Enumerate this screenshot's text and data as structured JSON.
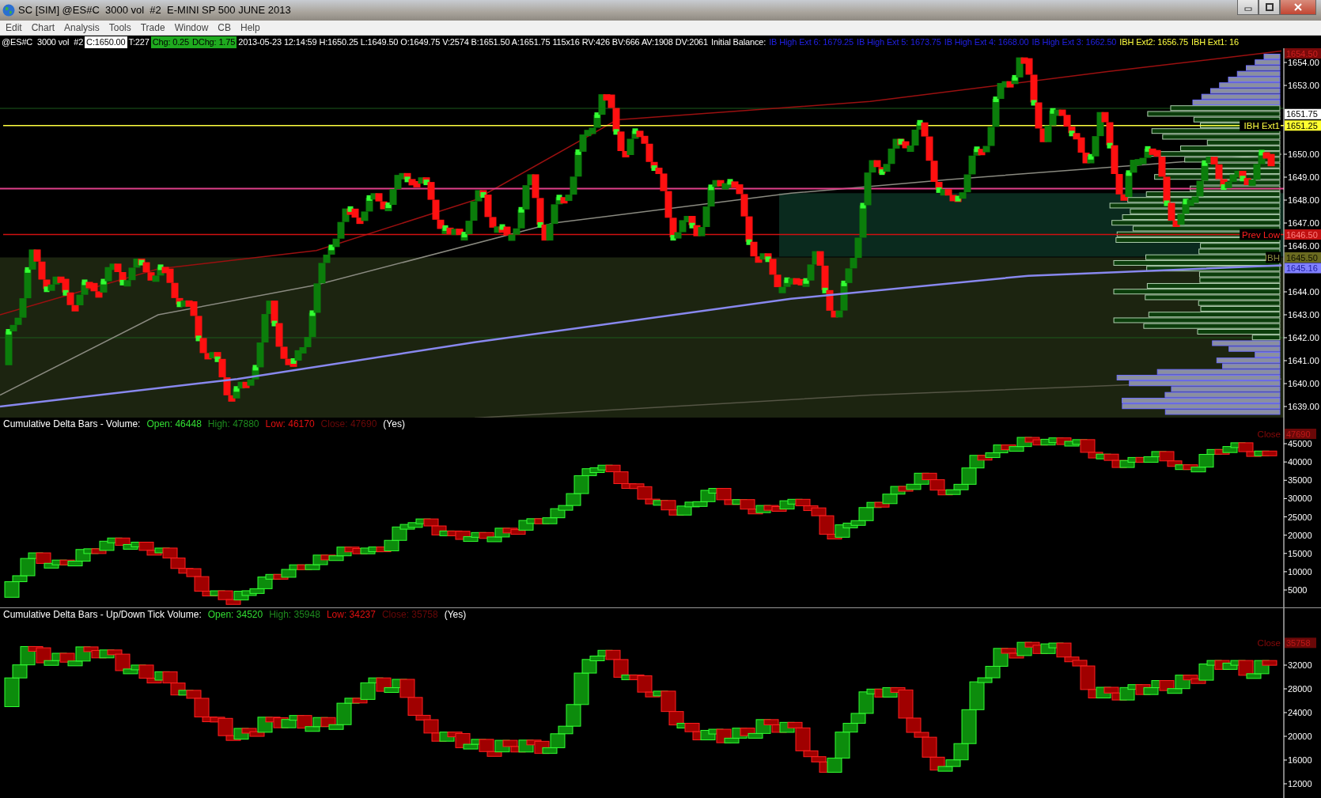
{
  "window": {
    "title": "SC [SIM] @ES#C  3000 vol  #2  E-MINI SP 500 JUNE 2013"
  },
  "menu": [
    "Edit",
    "Chart",
    "Analysis",
    "Tools",
    "Trade",
    "Window",
    "CB",
    "Help"
  ],
  "info_bar": [
    {
      "text": "@ES#C  3000 vol  #2",
      "kind": "plain"
    },
    {
      "text": "C:1650.00",
      "kind": "box",
      "color": "#ffffff"
    },
    {
      "text": "T:227",
      "kind": "plain"
    },
    {
      "text": "Chg: 0.25",
      "kind": "box",
      "color": "#1faa1f"
    },
    {
      "text": "DChg: 1.75",
      "kind": "box",
      "color": "#1faa1f"
    },
    {
      "text": "2013-05-23 12:14:59 H:1650.25 L:1649.50 O:1649.75 V:2574 B:1651.50 A:1651.75 115x16 RV:426 BV:666 AV:1908 DV:2061",
      "kind": "plain"
    },
    {
      "text": "Initial Balance:",
      "kind": "plain"
    },
    {
      "text": "IB High Ext 6: 1679.25",
      "kind": "plain",
      "color": "#2020e0"
    },
    {
      "text": "IB High Ext 5: 1673.75",
      "kind": "plain",
      "color": "#2020e0"
    },
    {
      "text": "IB High Ext 4: 1668.00",
      "kind": "plain",
      "color": "#2020e0"
    },
    {
      "text": "IB High Ext 3: 1662.50",
      "kind": "plain",
      "color": "#2020e0"
    },
    {
      "text": "IBH Ext2: 1656.75",
      "kind": "plain",
      "color": "#ffff40"
    },
    {
      "text": "IBH Ext1: 16",
      "kind": "plain",
      "color": "#ffff40"
    }
  ],
  "main_chart": {
    "axis_labels": [
      "1654.00",
      "1653.00",
      "1650.00",
      "1649.00",
      "1648.00",
      "1647.00",
      "1646.00",
      "1644.00",
      "1643.00",
      "1642.00",
      "1641.00",
      "1640.00",
      "1639.00"
    ],
    "price_tags": [
      {
        "text": "1654.50",
        "kind": "darkred"
      },
      {
        "text": "1651.75",
        "kind": "white"
      },
      {
        "text": "1651.25",
        "kind": "yellow",
        "label": "IBH Ext1"
      },
      {
        "text": "1646.50",
        "kind": "red",
        "label": "Prev Low"
      },
      {
        "text": "1645.50",
        "kind": "olive",
        "label": "IBH"
      },
      {
        "text": "1645.16",
        "kind": "blue"
      }
    ]
  },
  "subgraphs": [
    {
      "title": "Cumulative Delta Bars - Volume:",
      "stats": [
        {
          "text": "Open: 46448",
          "color": "#33dd33"
        },
        {
          "text": "High: 47880",
          "color": "#1e8a1e"
        },
        {
          "text": "Low: 46170",
          "color": "#e01010"
        },
        {
          "text": "Close: 47690",
          "color": "#6a0808"
        },
        {
          "text": "(Yes)",
          "color": "#ffffff"
        }
      ],
      "axis_labels": [
        "45000",
        "40000",
        "35000",
        "30000",
        "25000",
        "20000",
        "15000",
        "10000",
        "5000"
      ],
      "close_label": "Close",
      "close_tag": "47690"
    },
    {
      "title": "Cumulative Delta Bars - Up/Down Tick Volume:",
      "stats": [
        {
          "text": "Open: 34520",
          "color": "#33dd33"
        },
        {
          "text": "High: 35948",
          "color": "#1e8a1e"
        },
        {
          "text": "Low: 34237",
          "color": "#e01010"
        },
        {
          "text": "Close: 35758",
          "color": "#6a0808"
        },
        {
          "text": "(Yes)",
          "color": "#ffffff"
        }
      ],
      "axis_labels": [
        "32000",
        "28000",
        "24000",
        "20000",
        "16000",
        "12000"
      ],
      "close_label": "Close",
      "close_tag": "35758"
    }
  ]
}
